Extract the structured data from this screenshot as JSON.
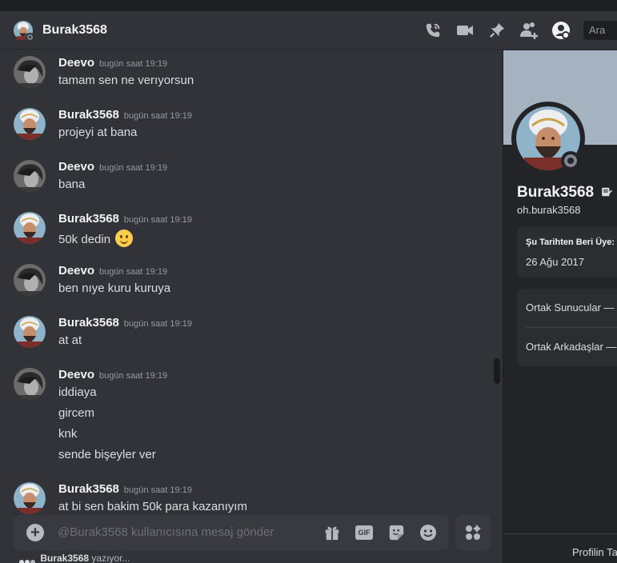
{
  "header": {
    "title": "Burak3568",
    "search_placeholder": "Ara",
    "icons": [
      "phone-call-icon",
      "video-camera-icon",
      "pin-icon",
      "add-friend-icon",
      "user-profile-icon"
    ]
  },
  "messages": [
    {
      "author": "Deevo",
      "time": "bugün saat 19:19",
      "lines": [
        "tamam sen ne verıyorsun"
      ]
    },
    {
      "author": "Burak3568",
      "time": "bugün saat 19:19",
      "lines": [
        "projeyi at bana"
      ]
    },
    {
      "author": "Deevo",
      "time": "bugün saat 19:19",
      "lines": [
        "bana"
      ]
    },
    {
      "author": "Burak3568",
      "time": "bugün saat 19:19",
      "lines": [
        "50k dedin"
      ]
    },
    {
      "author": "Deevo",
      "time": "bugün saat 19:19",
      "lines": [
        "ben nıye kuru kuruya"
      ]
    },
    {
      "author": "Burak3568",
      "time": "bugün saat 19:19",
      "lines": [
        "at at"
      ]
    },
    {
      "author": "Deevo",
      "time": "bugün saat 19:19",
      "lines": [
        "iddiaya",
        "gircem",
        "knk",
        "sende bişeyler ver"
      ]
    },
    {
      "author": "Burak3568",
      "time": "bugün saat 19:19",
      "lines": [
        "at bi sen bakim 50k para kazanıyım"
      ]
    }
  ],
  "composer": {
    "placeholder": "@Burak3568 kullanıcısına mesaj gönder",
    "gif_label": "GIF"
  },
  "typing": {
    "user": "Burak3568",
    "suffix": "yazıyor..."
  },
  "profile": {
    "display_name": "Burak3568",
    "username": "oh.burak3568",
    "member_since_label": "Şu Tarihten Beri Üye:",
    "member_since_value": "26 Ağu 2017",
    "mutual_servers": "Ortak Sunucular —",
    "mutual_friends": "Ortak Arkadaşlar —",
    "footer": "Profilin Ta"
  },
  "colors": {
    "background": "#313338",
    "panel": "#232428",
    "banner": "#a4b3bf",
    "offline_status": "#80848e"
  }
}
